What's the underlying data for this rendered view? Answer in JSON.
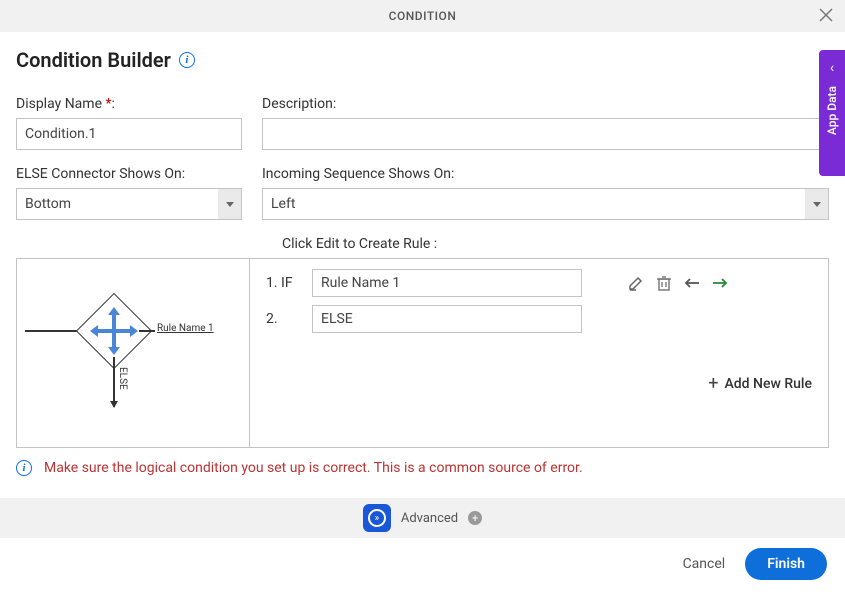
{
  "header": {
    "title": "CONDITION"
  },
  "page": {
    "title": "Condition Builder"
  },
  "form": {
    "display_name_label": "Display Name",
    "display_name_value": "Condition.1",
    "description_label": "Description:",
    "description_value": "",
    "else_label": "ELSE Connector Shows On:",
    "else_value": "Bottom",
    "incoming_label": "Incoming Sequence Shows On:",
    "incoming_value": "Left",
    "click_edit_label": "Click Edit to Create Rule :"
  },
  "rules": [
    {
      "num": "1.",
      "prefix": "IF",
      "value": "Rule Name 1"
    },
    {
      "num": "2.",
      "prefix": "",
      "value": "ELSE"
    }
  ],
  "add_rule_label": "Add New Rule",
  "warning": "Make sure the logical condition you set up is correct. This is a common source of error.",
  "diagram": {
    "rule_label": "Rule Name 1",
    "else_label": "ELSE"
  },
  "advanced": {
    "label": "Advanced"
  },
  "footer": {
    "cancel": "Cancel",
    "finish": "Finish"
  },
  "side_tab": {
    "label": "App Data"
  }
}
